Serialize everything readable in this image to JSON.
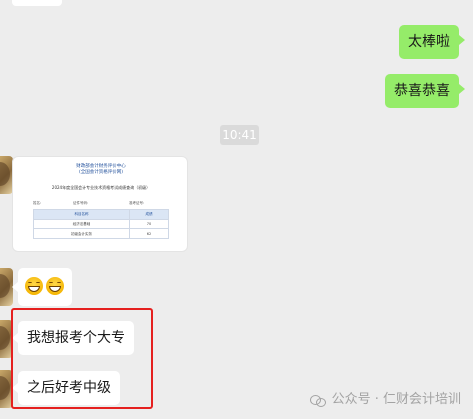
{
  "messages_out": [
    {
      "text": "太棒啦"
    },
    {
      "text": "恭喜恭喜"
    }
  ],
  "timestamp": "10:41",
  "document": {
    "org_line1": "财政部会计财务评价中心",
    "org_line2": "(全国会计资格评价网)",
    "title": "2024年度全国会计专业技术资格考试成绩查询（初级）",
    "info_left": "姓名:",
    "info_mid": "证件号码:",
    "info_right": "准考证号:",
    "table_headers": [
      "科目名称",
      "成绩"
    ],
    "table_rows": [
      [
        "经济法基础",
        "70"
      ],
      [
        "初级会计实务",
        "62"
      ]
    ]
  },
  "messages_in": [
    {
      "text": "我想报考个大专"
    },
    {
      "text": "之后好考中级"
    }
  ],
  "watermark": {
    "icon": "wechat-icon",
    "text": "公众号 · 仁财会计培训"
  },
  "colors": {
    "bubble_out": "#95ec69",
    "bubble_in": "#ffffff",
    "background": "#ededed",
    "highlight": "#e5201f"
  }
}
